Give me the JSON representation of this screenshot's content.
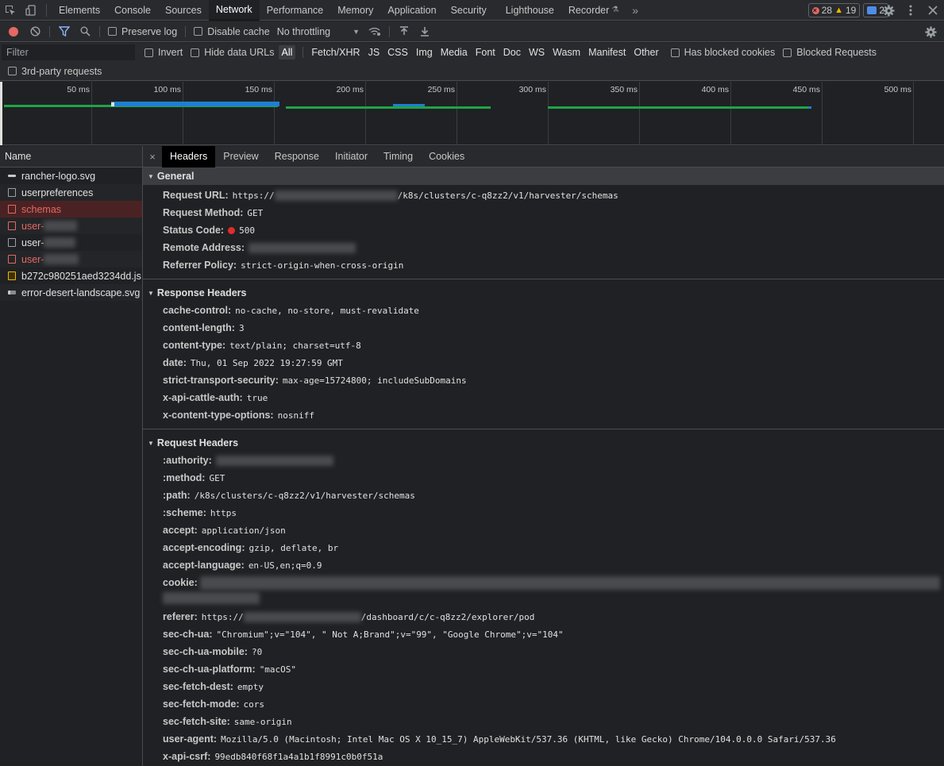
{
  "topbar": {
    "tabs": [
      "Elements",
      "Console",
      "Sources",
      "Network",
      "Performance",
      "Memory",
      "Application",
      "Security",
      "Lighthouse",
      "Recorder"
    ],
    "active_tab": "Network",
    "errors": "28",
    "warnings": "19",
    "messages": "2"
  },
  "toolbar": {
    "preserve_log": "Preserve log",
    "disable_cache": "Disable cache",
    "throttling": "No throttling"
  },
  "filter": {
    "placeholder": "Filter",
    "invert": "Invert",
    "hide_data_urls": "Hide data URLs",
    "types": [
      "All",
      "Fetch/XHR",
      "JS",
      "CSS",
      "Img",
      "Media",
      "Font",
      "Doc",
      "WS",
      "Wasm",
      "Manifest",
      "Other"
    ],
    "blocked_cookies": "Has blocked cookies",
    "blocked_requests": "Blocked Requests",
    "third_party": "3rd-party requests"
  },
  "overview": {
    "ticks": [
      "50 ms",
      "100 ms",
      "150 ms",
      "200 ms",
      "250 ms",
      "300 ms",
      "350 ms",
      "400 ms",
      "450 ms",
      "500 ms"
    ]
  },
  "requests": {
    "header": "Name",
    "items": [
      {
        "name": "rancher-logo.svg"
      },
      {
        "name": "userpreferences"
      },
      {
        "name": "schemas"
      },
      {
        "name": "user-"
      },
      {
        "name": "user-"
      },
      {
        "name": "user-"
      },
      {
        "name": "b272c980251aed3234dd.js"
      },
      {
        "name": "error-desert-landscape.svg"
      }
    ]
  },
  "detail": {
    "tabs": [
      "Headers",
      "Preview",
      "Response",
      "Initiator",
      "Timing",
      "Cookies"
    ],
    "active_tab": "Headers",
    "general": {
      "title": "General",
      "request_url_key": "Request URL:",
      "request_url_prefix": "https://",
      "request_url_suffix": "/k8s/clusters/c-q8zz2/v1/harvester/schemas",
      "method_key": "Request Method:",
      "method": "GET",
      "status_key": "Status Code:",
      "status": "500",
      "remote_key": "Remote Address:",
      "referrer_policy_key": "Referrer Policy:",
      "referrer_policy": "strict-origin-when-cross-origin"
    },
    "response_headers": {
      "title": "Response Headers",
      "items": [
        {
          "k": "cache-control:",
          "v": "no-cache, no-store, must-revalidate"
        },
        {
          "k": "content-length:",
          "v": "3"
        },
        {
          "k": "content-type:",
          "v": "text/plain; charset=utf-8"
        },
        {
          "k": "date:",
          "v": "Thu, 01 Sep 2022 19:27:59 GMT"
        },
        {
          "k": "strict-transport-security:",
          "v": "max-age=15724800; includeSubDomains"
        },
        {
          "k": "x-api-cattle-auth:",
          "v": "true"
        },
        {
          "k": "x-content-type-options:",
          "v": "nosniff"
        }
      ]
    },
    "request_headers": {
      "title": "Request Headers",
      "authority_key": ":authority:",
      "items_a": [
        {
          "k": ":method:",
          "v": "GET"
        },
        {
          "k": ":path:",
          "v": "/k8s/clusters/c-q8zz2/v1/harvester/schemas"
        },
        {
          "k": ":scheme:",
          "v": "https"
        },
        {
          "k": "accept:",
          "v": "application/json"
        },
        {
          "k": "accept-encoding:",
          "v": "gzip, deflate, br"
        },
        {
          "k": "accept-language:",
          "v": "en-US,en;q=0.9"
        }
      ],
      "cookie_key": "cookie:",
      "referer_key": "referer:",
      "referer_prefix": "https://",
      "referer_suffix": "/dashboard/c/c-q8zz2/explorer/pod",
      "items_b": [
        {
          "k": "sec-ch-ua:",
          "v": "\"Chromium\";v=\"104\", \" Not A;Brand\";v=\"99\", \"Google Chrome\";v=\"104\""
        },
        {
          "k": "sec-ch-ua-mobile:",
          "v": "?0"
        },
        {
          "k": "sec-ch-ua-platform:",
          "v": "\"macOS\""
        },
        {
          "k": "sec-fetch-dest:",
          "v": "empty"
        },
        {
          "k": "sec-fetch-mode:",
          "v": "cors"
        },
        {
          "k": "sec-fetch-site:",
          "v": "same-origin"
        },
        {
          "k": "user-agent:",
          "v": "Mozilla/5.0 (Macintosh; Intel Mac OS X 10_15_7) AppleWebKit/537.36 (KHTML, like Gecko) Chrome/104.0.0.0 Safari/537.36"
        },
        {
          "k": "x-api-csrf:",
          "v": "99edb840f68f1a4a1b1f8991c0b0f51a"
        }
      ]
    }
  }
}
